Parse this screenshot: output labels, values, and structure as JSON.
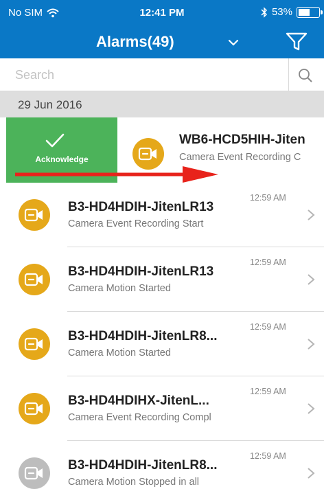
{
  "status_bar": {
    "carrier": "No SIM",
    "time": "12:41 PM",
    "battery": "53%",
    "battery_level": 0.53,
    "icons": [
      "wifi-icon",
      "bluetooth-icon",
      "battery-icon"
    ]
  },
  "header": {
    "title": "Alarms(49)",
    "icons": [
      "chevron-down-icon",
      "filter-icon"
    ]
  },
  "search": {
    "placeholder": "Search",
    "icon": "search-icon"
  },
  "date_group": "29 Jun 2016",
  "swiped_alarm": {
    "action_label": "Acknowledge",
    "action_icon": "checkmark-icon",
    "name": "WB6-HCD5HIH-Jiten",
    "description": "Camera Event Recording C",
    "icon": "camera-icon"
  },
  "alarms": [
    {
      "name": "B3-HD4HDIH-JitenLR13",
      "description": "Camera Event Recording Start",
      "time": "12:59 AM",
      "icon": "camera-icon"
    },
    {
      "name": "B3-HD4HDIH-JitenLR13",
      "description": "Camera Motion Started",
      "time": "12:59 AM",
      "icon": "camera-icon"
    },
    {
      "name": "B3-HD4HDIH-JitenLR8...",
      "description": "Camera Motion Started",
      "time": "12:59 AM",
      "icon": "camera-icon"
    },
    {
      "name": "B3-HD4HDIHX-JitenL...",
      "description": "Camera Event Recording Compl",
      "time": "12:59 AM",
      "icon": "camera-icon"
    },
    {
      "name": "B3-HD4HDIH-JitenLR8...",
      "description": "Camera Motion Stopped in all",
      "time": "12:59 AM",
      "icon": "camera-icon"
    }
  ],
  "colors": {
    "header": "#0a78c6",
    "acknowledge": "#4cb35a",
    "camera_active": "#e5a81a",
    "camera_inactive": "#bdbdbd",
    "swipe_arrow": "#e8231b",
    "date_header": "#dedede"
  }
}
